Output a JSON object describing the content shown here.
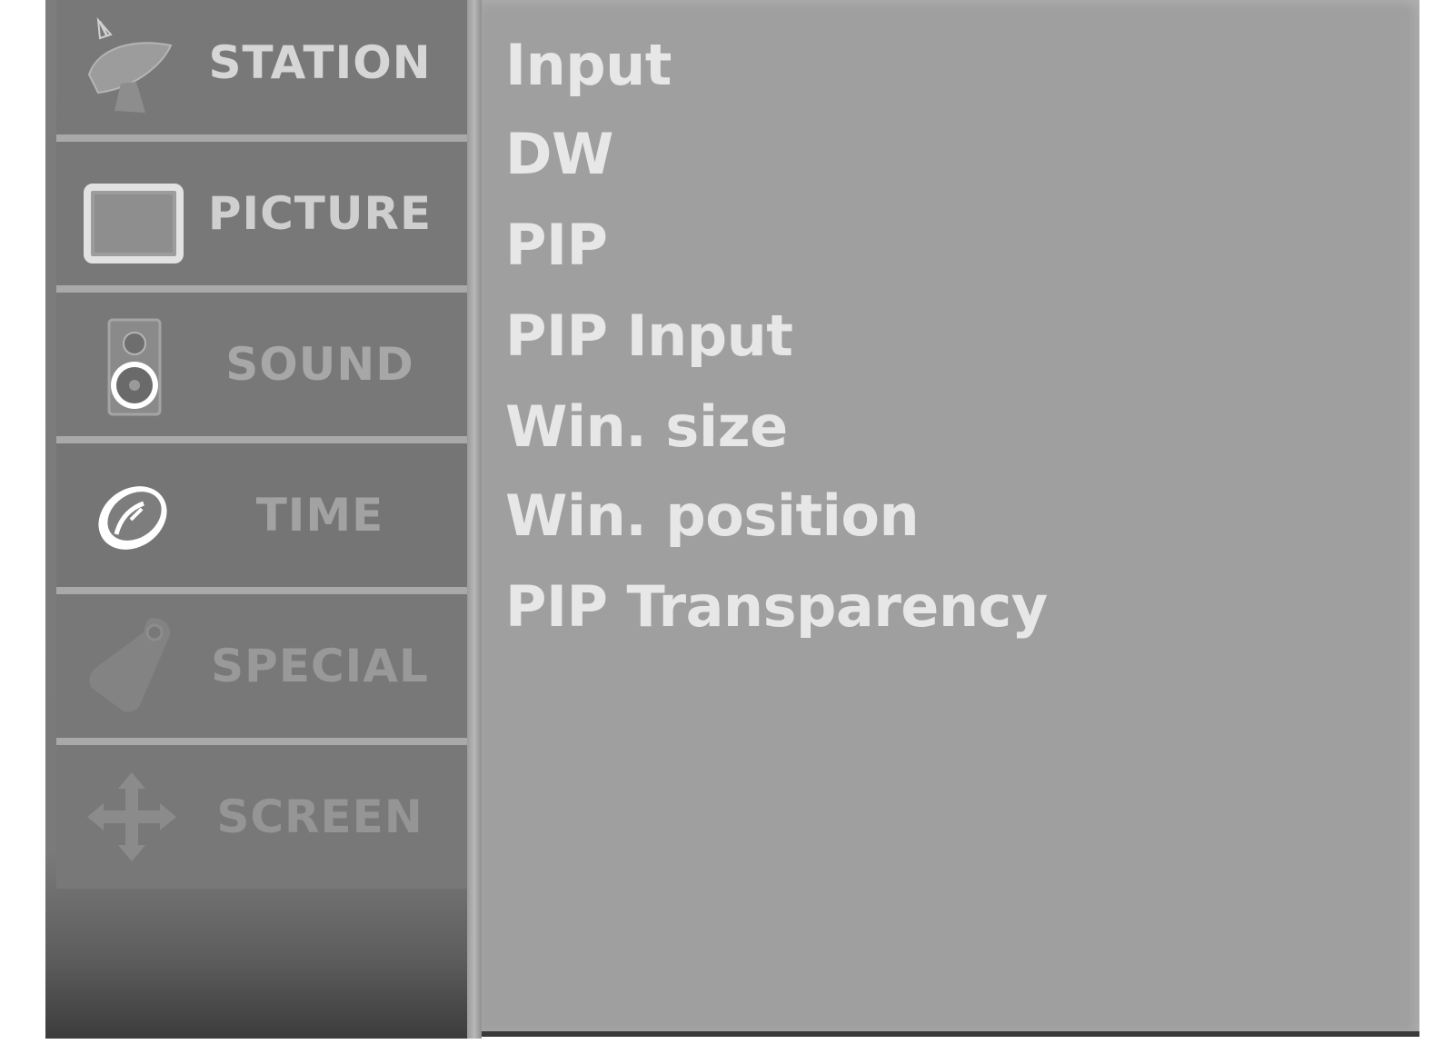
{
  "sidebar": {
    "items": [
      {
        "id": "station",
        "label": "STATION",
        "icon": "satellite-dish-icon"
      },
      {
        "id": "picture",
        "label": "PICTURE",
        "icon": "monitor-icon"
      },
      {
        "id": "sound",
        "label": "SOUND",
        "icon": "speaker-icon"
      },
      {
        "id": "time",
        "label": "TIME",
        "icon": "clock-icon"
      },
      {
        "id": "special",
        "label": "SPECIAL",
        "icon": "tag-icon"
      },
      {
        "id": "screen",
        "label": "SCREEN",
        "icon": "move-arrows-icon"
      }
    ]
  },
  "submenu": {
    "items": [
      {
        "label": "Input"
      },
      {
        "label": "DW"
      },
      {
        "label": "PIP"
      },
      {
        "label": "PIP Input"
      },
      {
        "label": "Win. size"
      },
      {
        "label": "Win. position"
      },
      {
        "label": "PIP Transparency"
      }
    ]
  },
  "colors": {
    "sidebar_bg": "#7a7a7a",
    "submenu_bg": "#9f9f9f",
    "text": "#e7e7e7"
  }
}
